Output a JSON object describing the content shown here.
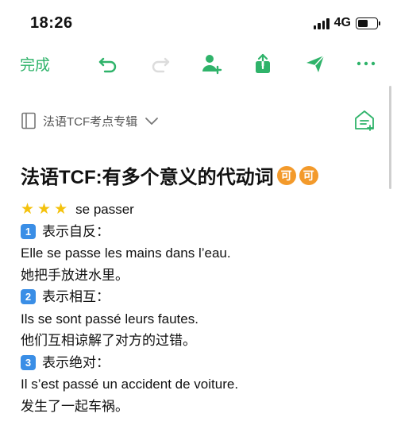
{
  "status": {
    "time": "18:26",
    "network": "4G"
  },
  "toolbar": {
    "done_label": "完成",
    "icons": [
      "undo-icon",
      "redo-icon",
      "add-person-icon",
      "share-icon",
      "send-icon",
      "more-icon"
    ]
  },
  "notebook": {
    "label": "法语TCF考点专辑"
  },
  "note": {
    "title": "法语TCF:有多个意义的代动词",
    "title_emoji": "可",
    "heading": "se passer",
    "sections": [
      {
        "num": "1",
        "label": "表示自反：",
        "fr": "Elle se passe les mains dans l’eau.",
        "zh": "她把手放进水里。"
      },
      {
        "num": "2",
        "label": "表示相互：",
        "fr": "Ils se sont passé leurs fautes.",
        "zh": "他们互相谅解了对方的过错。"
      },
      {
        "num": "3",
        "label": "表示绝对：",
        "fr": "Il s’est passé un accident de voiture.",
        "zh": "发生了一起车祸。"
      }
    ]
  },
  "colors": {
    "accent": "#2fb36a",
    "keycap": "#3a8ee6",
    "star": "#f4c20d",
    "emoji": "#f39a2b"
  }
}
